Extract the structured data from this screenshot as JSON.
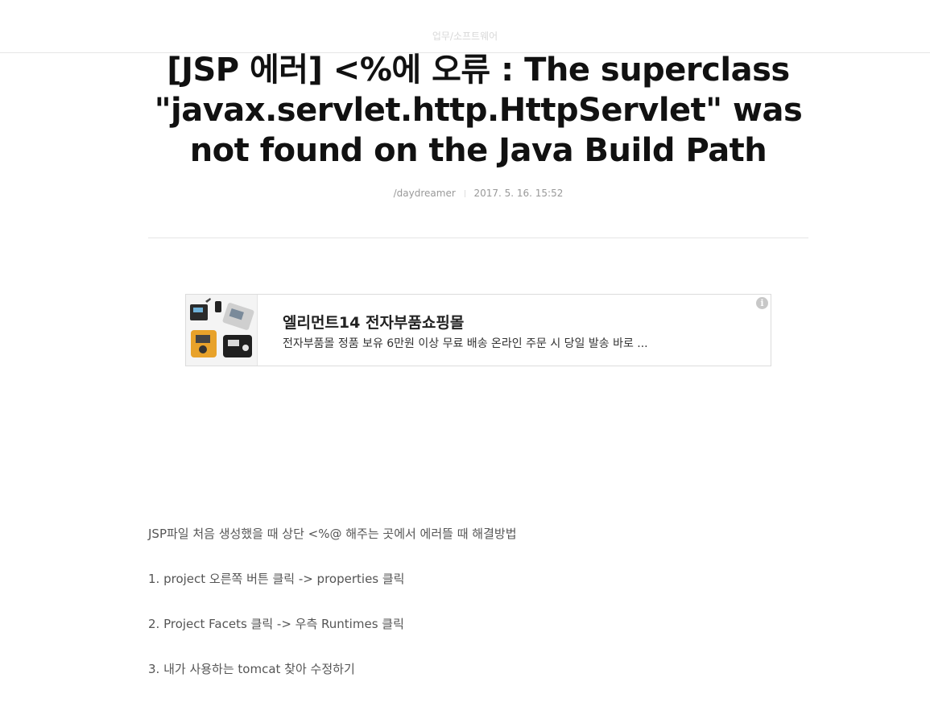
{
  "header": {
    "category": "업무/소프트웨어"
  },
  "post": {
    "title": "[JSP 에러] <%에 오류 : The superclass \"javax.servlet.http.HttpServlet\" was not found on the Java Build Path",
    "author": "/daydreamer",
    "date": "2017. 5. 16. 15:52"
  },
  "ad": {
    "title": "엘리먼트14 전자부품쇼핑몰",
    "description": "전자부품몰 정품 보유 6만원 이상 무료 배송 온라인 주문 시 당일 발송 바로 ...",
    "info_icon": "i"
  },
  "content": {
    "paragraphs": [
      "JSP파일 처음 생성했을 때 상단 <%@ 해주는 곳에서 에러뜰 때 해결방법",
      "1. project 오른쪽 버튼 클릭 -> properties 클릭",
      "2. Project Facets 클릭 -> 우측 Runtimes 클릭",
      "3. 내가 사용하는 tomcat 찾아 수정하기"
    ]
  },
  "colors": {
    "title": "#111111",
    "meta": "#999999",
    "body_text": "#555555",
    "divider": "#e5e5e5"
  }
}
